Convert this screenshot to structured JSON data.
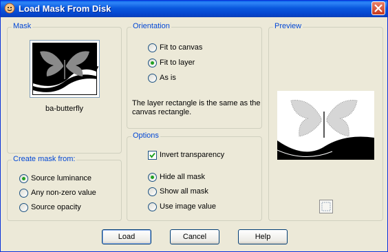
{
  "window": {
    "title": "Load Mask From Disk"
  },
  "mask": {
    "legend": "Mask",
    "selected_name": "ba-butterfly"
  },
  "create_from": {
    "legend": "Create mask from:",
    "options": [
      {
        "label": "Source luminance",
        "selected": true
      },
      {
        "label": "Any non-zero value",
        "selected": false
      },
      {
        "label": "Source opacity",
        "selected": false
      }
    ]
  },
  "orientation": {
    "legend": "Orientation",
    "options": [
      {
        "label": "Fit to canvas",
        "selected": false
      },
      {
        "label": "Fit to layer",
        "selected": true
      },
      {
        "label": "As is",
        "selected": false
      }
    ],
    "info_line1": "The layer rectangle is the same as the",
    "info_line2": "canvas rectangle."
  },
  "options": {
    "legend": "Options",
    "invert_label": "Invert transparency",
    "invert_checked": true,
    "visibility": [
      {
        "label": "Hide all mask",
        "selected": true
      },
      {
        "label": "Show all mask",
        "selected": false
      },
      {
        "label": "Use image value",
        "selected": false
      }
    ]
  },
  "preview": {
    "legend": "Preview"
  },
  "buttons": {
    "load": "Load",
    "cancel": "Cancel",
    "help": "Help"
  },
  "colors": {
    "titlebar": "#0a58de",
    "legend_text": "#0046d5",
    "dialog_bg": "#ece9d8"
  }
}
